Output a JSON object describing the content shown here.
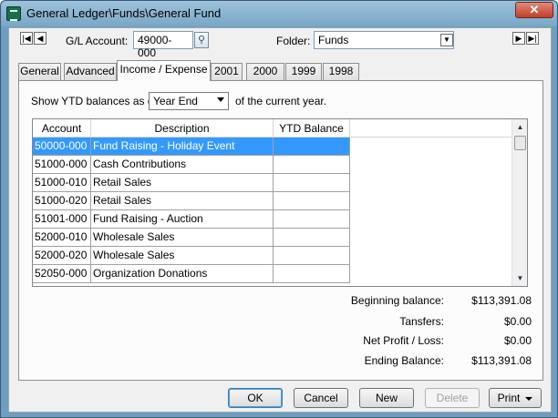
{
  "window": {
    "title": "General Ledger\\Funds\\General Fund",
    "close_glyph": "✕"
  },
  "header": {
    "gl_account_label": "G/L Account:",
    "gl_account_value": "49000-000",
    "folder_label": "Folder:",
    "folder_value": "Funds",
    "nav_first": "|◀",
    "nav_prev": "◀",
    "nav_next": "▶",
    "nav_last": "▶|"
  },
  "tabs": [
    {
      "label": "General"
    },
    {
      "label": "Advanced"
    },
    {
      "label": "Income / Expense"
    },
    {
      "label": "2001"
    },
    {
      "label": "2000"
    },
    {
      "label": "1999"
    },
    {
      "label": "1998"
    }
  ],
  "ytd": {
    "prefix": "Show YTD balances as of",
    "selected": "Year End",
    "suffix": "of the current year."
  },
  "grid": {
    "columns": [
      "Account",
      "Description",
      "YTD Balance"
    ],
    "rows": [
      {
        "account": "50000-000",
        "description": "Fund Raising - Holiday Event",
        "balance": ""
      },
      {
        "account": "51000-000",
        "description": "Cash Contributions",
        "balance": ""
      },
      {
        "account": "51000-010",
        "description": "Retail Sales",
        "balance": ""
      },
      {
        "account": "51000-020",
        "description": "Retail Sales",
        "balance": ""
      },
      {
        "account": "51001-000",
        "description": "Fund Raising - Auction",
        "balance": ""
      },
      {
        "account": "52000-010",
        "description": "Wholesale Sales",
        "balance": ""
      },
      {
        "account": "52000-020",
        "description": "Wholesale Sales",
        "balance": ""
      },
      {
        "account": "52050-000",
        "description": "Organization Donations",
        "balance": ""
      }
    ]
  },
  "summary": {
    "beginning_label": "Beginning balance:",
    "beginning_value": "$113,391.08",
    "transfers_label": "Tansfers:",
    "transfers_value": "$0.00",
    "net_label": "Net Profit / Loss:",
    "net_value": "$0.00",
    "ending_label": "Ending Balance:",
    "ending_value": "$113,391.08"
  },
  "buttons": {
    "ok": "OK",
    "cancel": "Cancel",
    "new": "New",
    "delete": "Delete",
    "print": "Print"
  },
  "colors": {
    "selection": "#3399ff",
    "titlebar": "#78a7c6"
  }
}
